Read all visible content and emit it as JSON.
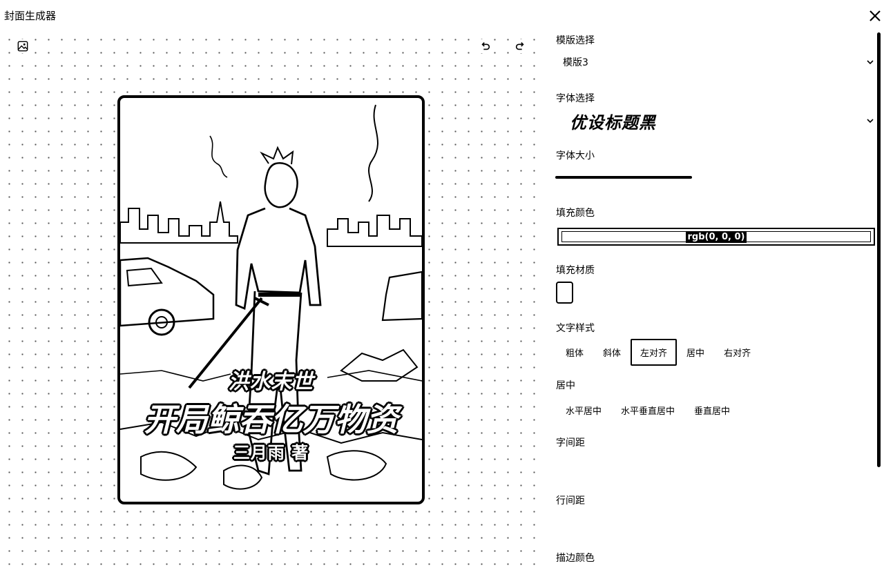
{
  "window": {
    "title": "封面生成器"
  },
  "toolbar": {
    "image_icon": "image-icon",
    "undo_icon": "undo-icon",
    "redo_icon": "redo-icon"
  },
  "cover": {
    "subtitle": "洪水末世",
    "title": "开局鲸吞亿万物资",
    "author": "三月雨 著"
  },
  "panel": {
    "template": {
      "label": "模版选择",
      "value": "模版3"
    },
    "font": {
      "label": "字体选择",
      "value": "优设标题黑"
    },
    "font_size": {
      "label": "字体大小"
    },
    "fill_color": {
      "label": "填充颜色",
      "value": "rgb(0, 0, 0)"
    },
    "fill_texture": {
      "label": "填充材质"
    },
    "text_style": {
      "label": "文字样式",
      "options": [
        "粗体",
        "斜体",
        "左对齐",
        "居中",
        "右对齐"
      ],
      "active_index": 2
    },
    "align": {
      "label": "居中",
      "options": [
        "水平居中",
        "水平垂直居中",
        "垂直居中"
      ]
    },
    "letter_spacing": {
      "label": "字间距"
    },
    "line_height": {
      "label": "行间距"
    },
    "stroke_color": {
      "label": "描边颜色"
    }
  },
  "colors": {
    "accent": "#000000",
    "background": "#ffffff"
  }
}
